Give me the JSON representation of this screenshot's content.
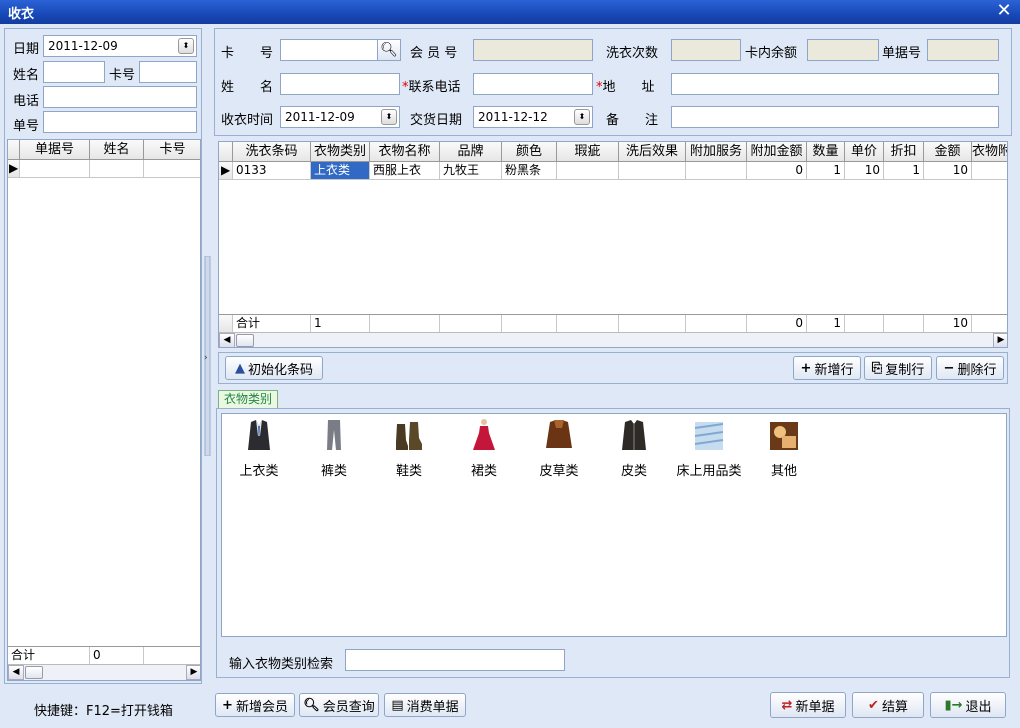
{
  "window": {
    "title": "收衣"
  },
  "left": {
    "date_label": "日期",
    "date_value": "2011-12-09",
    "name_label": "姓名",
    "card_label": "卡号",
    "phone_label": "电话",
    "order_label": "单号",
    "grid_headers": [
      "单据号",
      "姓名",
      "卡号"
    ],
    "total_label": "合计",
    "total_value": "0"
  },
  "form": {
    "card_no_label": "卡　　号",
    "member_no_label": "会 员 号",
    "wash_count_label": "洗衣次数",
    "balance_label": "卡内余额",
    "bill_no_label": "单据号",
    "name_label": "姓　　名",
    "contact_label": "联系电话",
    "address_label": "地　　址",
    "receive_time_label": "收衣时间",
    "receive_time_value": "2011-12-09",
    "delivery_date_label": "交货日期",
    "delivery_date_value": "2011-12-12",
    "remark_label": "备　　注"
  },
  "items_grid": {
    "headers": [
      "洗衣条码",
      "衣物类别",
      "衣物名称",
      "品牌",
      "颜色",
      "瑕疵",
      "洗后效果",
      "附加服务",
      "附加金额",
      "数量",
      "单价",
      "折扣",
      "金额",
      "衣物附"
    ],
    "rows": [
      [
        "0133",
        "上衣类",
        "西服上衣",
        "九牧王",
        "粉黑条",
        "",
        "",
        "",
        "0",
        "1",
        "10",
        "1",
        "10",
        ""
      ]
    ],
    "footer": [
      "合计",
      "1",
      "",
      "",
      "",
      "",
      "",
      "",
      "0",
      "1",
      "",
      "",
      "10",
      ""
    ]
  },
  "toolbar": {
    "init_barcode": "初始化条码",
    "add_row": "新增行",
    "copy_row": "复制行",
    "delete_row": "删除行"
  },
  "category": {
    "tab_label": "衣物类别",
    "items": [
      {
        "label": "上衣类",
        "icon": "jacket-icon"
      },
      {
        "label": "裤类",
        "icon": "pants-icon"
      },
      {
        "label": "鞋类",
        "icon": "boots-icon"
      },
      {
        "label": "裙类",
        "icon": "dress-icon"
      },
      {
        "label": "皮草类",
        "icon": "fur-coat-icon"
      },
      {
        "label": "皮类",
        "icon": "leather-jacket-icon"
      },
      {
        "label": "床上用品类",
        "icon": "bedding-icon"
      },
      {
        "label": "其他",
        "icon": "other-icon"
      }
    ],
    "search_label": "输入衣物类别检索"
  },
  "bottom": {
    "shortcut": "快捷键：F12=打开钱箱",
    "add_member": "新增会员",
    "member_query": "会员查询",
    "consume_bill": "消费单据",
    "new_bill": "新单据",
    "checkout": "结算",
    "exit": "退出"
  }
}
